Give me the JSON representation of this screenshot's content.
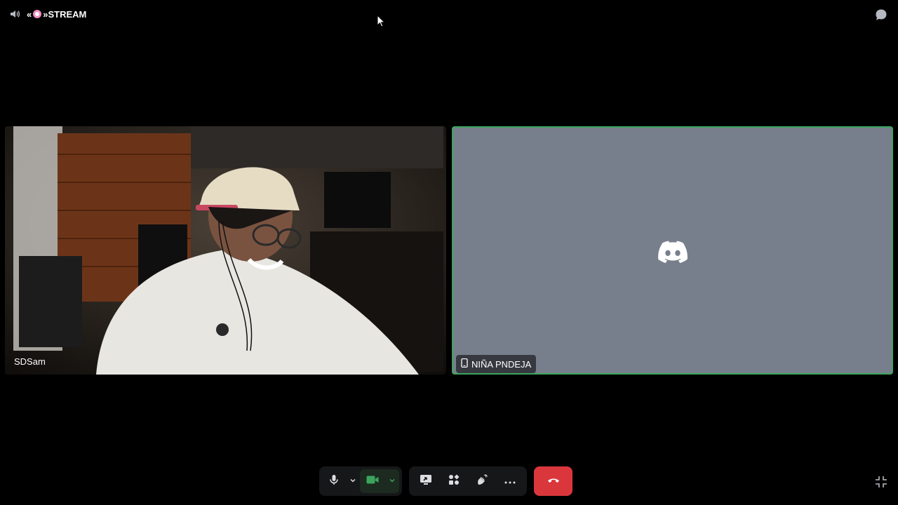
{
  "header": {
    "channel_prefix": "«",
    "channel_suffix": "»STREAM"
  },
  "tiles": [
    {
      "name": "SDSam",
      "kind": "camera"
    },
    {
      "name": "NIÑA PNDEJA",
      "kind": "avatar",
      "speaking": true,
      "device": "mobile"
    }
  ],
  "controls": {
    "mic": "microphone-icon",
    "mic_options": "chevron-down-icon",
    "camera": "video-camera-icon",
    "camera_options": "chevron-down-icon",
    "share_screen": "screen-share-icon",
    "activities": "activities-icon",
    "soundboard": "soundboard-icon",
    "more": "more-icon",
    "disconnect": "hang-up-icon"
  },
  "colors": {
    "background": "#000000",
    "avatar_tile": "#787f8c",
    "speaking_border": "#3ba55d",
    "camera_on": "#3ba55d",
    "disconnect": "#da373c"
  }
}
